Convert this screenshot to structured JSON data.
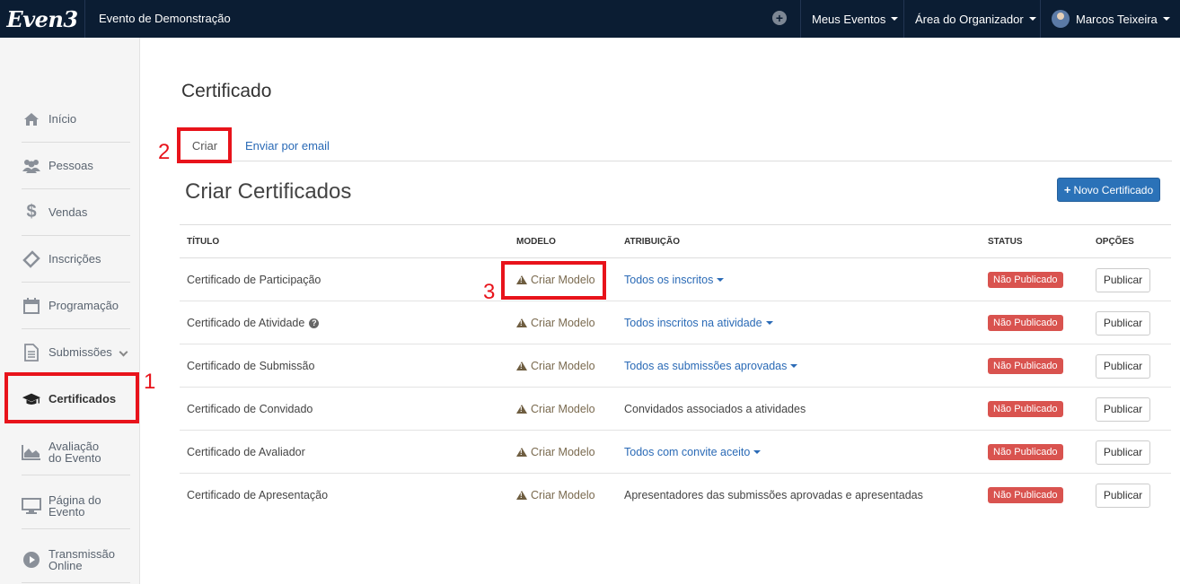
{
  "topbar": {
    "logo": "Even3",
    "event_name": "Evento de Demonstração",
    "menu_events": "Meus Eventos",
    "menu_organizer": "Área do Organizador",
    "user_name": "Marcos Teixeira"
  },
  "sidebar": {
    "items": [
      {
        "label": "Início",
        "icon": "home-icon"
      },
      {
        "label": "Pessoas",
        "icon": "users-icon"
      },
      {
        "label": "Vendas",
        "icon": "dollar-icon"
      },
      {
        "label": "Inscrições",
        "icon": "ticket-icon"
      },
      {
        "label": "Programação",
        "icon": "calendar-icon"
      },
      {
        "label": "Submissões",
        "icon": "document-icon"
      },
      {
        "label": "Certificados",
        "icon": "graduation-cap-icon"
      },
      {
        "label_1": "Avaliação",
        "label_2": "do Evento",
        "icon": "area-chart-icon"
      },
      {
        "label_1": "Página do",
        "label_2": "Evento",
        "icon": "monitor-icon"
      },
      {
        "label_1": "Transmissão",
        "label_2": "Online",
        "icon": "play-icon"
      }
    ]
  },
  "main": {
    "page_title": "Certificado",
    "tabs": [
      {
        "label": "Criar"
      },
      {
        "label": "Enviar por email"
      }
    ],
    "section_title": "Criar Certificados",
    "new_button": "Novo Certificado"
  },
  "table": {
    "headers": [
      "TÍTULO",
      "MODELO",
      "ATRIBUIÇÃO",
      "STATUS",
      "OPÇÕES"
    ],
    "rows": [
      {
        "title": "Certificado de Participação",
        "model": "Criar Modelo",
        "attribution": "Todos os inscritos",
        "status": "Não Publicado",
        "option": "Publicar"
      },
      {
        "title": "Certificado de Atividade",
        "model": "Criar Modelo",
        "attribution": "Todos inscritos na atividade",
        "status": "Não Publicado",
        "option": "Publicar"
      },
      {
        "title": "Certificado de Submissão",
        "model": "Criar Modelo",
        "attribution": "Todos as submissões aprovadas",
        "status": "Não Publicado",
        "option": "Publicar"
      },
      {
        "title": "Certificado de Convidado",
        "model": "Criar Modelo",
        "attribution": "Convidados associados a atividades",
        "status": "Não Publicado",
        "option": "Publicar"
      },
      {
        "title": "Certificado de Avaliador",
        "model": "Criar Modelo",
        "attribution": "Todos com convite aceito",
        "status": "Não Publicado",
        "option": "Publicar"
      },
      {
        "title": "Certificado de Apresentação",
        "model": "Criar Modelo",
        "attribution": "Apresentadores das submissões aprovadas e apresentadas",
        "status": "Não Publicado",
        "option": "Publicar"
      }
    ]
  },
  "annotations": {
    "n1": "1",
    "n2": "2",
    "n3": "3"
  },
  "colors": {
    "topbar": "#0b1d33",
    "primary": "#2b72b8",
    "danger": "#d9534f",
    "annotation": "#e8131b"
  }
}
